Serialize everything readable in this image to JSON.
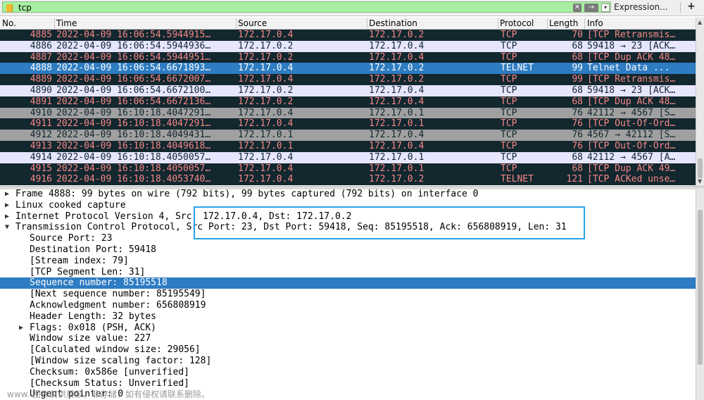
{
  "filter": {
    "value": "tcp",
    "expression_label": "Expression...",
    "plus_label": "+"
  },
  "packet_list": {
    "columns": [
      "No.",
      "Time",
      "Source",
      "Destination",
      "Protocol",
      "Length",
      "Info"
    ],
    "rows": [
      {
        "no": "4885",
        "time": "2022-04-09 16:06:54.5944915…",
        "src": "172.17.0.4",
        "dst": "172.17.0.2",
        "proto": "TCP",
        "len": "70",
        "info": "[TCP Retransmis…",
        "bg": "#12272e",
        "fg": "#f78787"
      },
      {
        "no": "4886",
        "time": "2022-04-09 16:06:54.5944936…",
        "src": "172.17.0.2",
        "dst": "172.17.0.4",
        "proto": "TCP",
        "len": "68",
        "info": "59418 → 23 [ACK…",
        "bg": "#e7e6ff",
        "fg": "#12272e"
      },
      {
        "no": "4887",
        "time": "2022-04-09 16:06:54.5944951…",
        "src": "172.17.0.2",
        "dst": "172.17.0.4",
        "proto": "TCP",
        "len": "68",
        "info": "[TCP Dup ACK 48…",
        "bg": "#12272e",
        "fg": "#f78787"
      },
      {
        "no": "4888",
        "time": "2022-04-09 16:06:54.6671893…",
        "src": "172.17.0.4",
        "dst": "172.17.0.2",
        "proto": "TELNET",
        "len": "99",
        "info": "Telnet Data ...",
        "bg": "#2e7cc2",
        "fg": "#ffffff"
      },
      {
        "no": "4889",
        "time": "2022-04-09 16:06:54.6672007…",
        "src": "172.17.0.4",
        "dst": "172.17.0.2",
        "proto": "TCP",
        "len": "99",
        "info": "[TCP Retransmis…",
        "bg": "#12272e",
        "fg": "#f78787"
      },
      {
        "no": "4890",
        "time": "2022-04-09 16:06:54.6672100…",
        "src": "172.17.0.2",
        "dst": "172.17.0.4",
        "proto": "TCP",
        "len": "68",
        "info": "59418 → 23 [ACK…",
        "bg": "#e7e6ff",
        "fg": "#12272e"
      },
      {
        "no": "4891",
        "time": "2022-04-09 16:06:54.6672136…",
        "src": "172.17.0.2",
        "dst": "172.17.0.4",
        "proto": "TCP",
        "len": "68",
        "info": "[TCP Dup ACK 48…",
        "bg": "#12272e",
        "fg": "#f78787"
      },
      {
        "no": "4910",
        "time": "2022-04-09 16:10:18.4047291…",
        "src": "172.17.0.4",
        "dst": "172.17.0.1",
        "proto": "TCP",
        "len": "76",
        "info": "42112 → 4567 [S…",
        "bg": "#a0a0a0",
        "fg": "#12272e"
      },
      {
        "no": "4911",
        "time": "2022-04-09 16:10:18.4047291…",
        "src": "172.17.0.4",
        "dst": "172.17.0.1",
        "proto": "TCP",
        "len": "76",
        "info": "[TCP Out-Of-Ord…",
        "bg": "#12272e",
        "fg": "#f78787"
      },
      {
        "no": "4912",
        "time": "2022-04-09 16:10:18.4049431…",
        "src": "172.17.0.1",
        "dst": "172.17.0.4",
        "proto": "TCP",
        "len": "76",
        "info": "4567 → 42112 [S…",
        "bg": "#a0a0a0",
        "fg": "#12272e"
      },
      {
        "no": "4913",
        "time": "2022-04-09 16:10:18.4049618…",
        "src": "172.17.0.1",
        "dst": "172.17.0.4",
        "proto": "TCP",
        "len": "76",
        "info": "[TCP Out-Of-Ord…",
        "bg": "#12272e",
        "fg": "#f78787"
      },
      {
        "no": "4914",
        "time": "2022-04-09 16:10:18.4050057…",
        "src": "172.17.0.4",
        "dst": "172.17.0.1",
        "proto": "TCP",
        "len": "68",
        "info": "42112 → 4567 [A…",
        "bg": "#e7e6ff",
        "fg": "#12272e"
      },
      {
        "no": "4915",
        "time": "2022-04-09 16:10:18.4050057…",
        "src": "172.17.0.4",
        "dst": "172.17.0.1",
        "proto": "TCP",
        "len": "68",
        "info": "[TCP Dup ACK 49…",
        "bg": "#12272e",
        "fg": "#f78787"
      },
      {
        "no": "4916",
        "time": "2022-04-09 16:10:18.4053740…",
        "src": "172.17.0.4",
        "dst": "172.17.0.2",
        "proto": "TELNET",
        "len": "121",
        "info": "[TCP ACKed unse…",
        "bg": "#12272e",
        "fg": "#f78787"
      }
    ]
  },
  "details": [
    {
      "indent": 0,
      "arrow": "right",
      "text": "Frame 4888: 99 bytes on wire (792 bits), 99 bytes captured (792 bits) on interface 0"
    },
    {
      "indent": 0,
      "arrow": "right",
      "text": "Linux cooked capture"
    },
    {
      "indent": 0,
      "arrow": "right",
      "text": "Internet Protocol Version 4, Src: 172.17.0.4, Dst: 172.17.0.2"
    },
    {
      "indent": 0,
      "arrow": "down",
      "text": "Transmission Control Protocol, Src Port: 23, Dst Port: 59418, Seq: 85195518, Ack: 656808919, Len: 31"
    },
    {
      "indent": 1,
      "arrow": "",
      "text": "Source Port: 23"
    },
    {
      "indent": 1,
      "arrow": "",
      "text": "Destination Port: 59418"
    },
    {
      "indent": 1,
      "arrow": "",
      "text": "[Stream index: 79]"
    },
    {
      "indent": 1,
      "arrow": "",
      "text": "[TCP Segment Len: 31]"
    },
    {
      "indent": 1,
      "arrow": "",
      "text": "Sequence number: 85195518",
      "selected": true
    },
    {
      "indent": 1,
      "arrow": "",
      "text": "[Next sequence number: 85195549]"
    },
    {
      "indent": 1,
      "arrow": "",
      "text": "Acknowledgment number: 656808919"
    },
    {
      "indent": 1,
      "arrow": "",
      "text": "Header Length: 32 bytes"
    },
    {
      "indent": 1,
      "arrow": "right",
      "text": "Flags: 0x018 (PSH, ACK)"
    },
    {
      "indent": 1,
      "arrow": "",
      "text": "Window size value: 227"
    },
    {
      "indent": 1,
      "arrow": "",
      "text": "[Calculated window size: 29056]"
    },
    {
      "indent": 1,
      "arrow": "",
      "text": "[Window size scaling factor: 128]"
    },
    {
      "indent": 1,
      "arrow": "",
      "text": "Checksum: 0x586e [unverified]"
    },
    {
      "indent": 1,
      "arrow": "",
      "text": "[Checksum Status: Unverified]"
    },
    {
      "indent": 1,
      "arrow": "",
      "text": "Urgent pointer: 0"
    }
  ],
  "watermark": "www.          图片仅供展示，非存储，如有侵权请联系删除。",
  "colors": {
    "selected": "#2e7cc2",
    "filter_ok": "#a8f0a0",
    "highlight_box": "#29a3e6"
  }
}
